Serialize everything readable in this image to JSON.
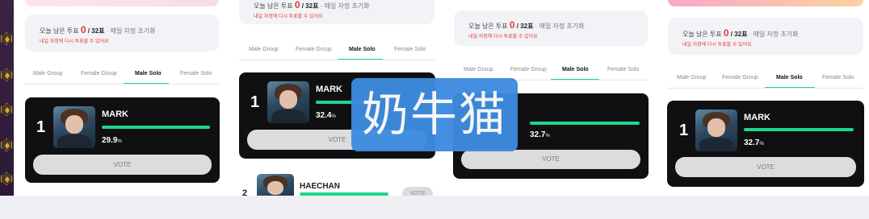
{
  "vote_info": {
    "prefix": "오늘 남은 투표 ",
    "remaining": "0",
    "total": " / 32표",
    "reset": " · 매일 자정 초기화",
    "note": "내일 자정에 다시 투표할 수 있어요"
  },
  "tabs": [
    "Male Group",
    "Female Group",
    "Male Solo",
    "Female Solo"
  ],
  "active_tab": "Male Solo",
  "panels": [
    {
      "rank": "1",
      "name": "MARK",
      "percent": "29.9",
      "unit": "%",
      "vote": "VOTE",
      "bar_fill": 0.86
    },
    {
      "rank": "1",
      "name": "MARK",
      "percent": "32.4",
      "unit": "%",
      "vote": "VOTE",
      "bar_fill": 0.55
    },
    {
      "rank": "",
      "name": "",
      "percent": "32.7",
      "unit": "%",
      "vote": "VOTE",
      "bar_fill": 0.55
    },
    {
      "rank": "1",
      "name": "MARK",
      "percent": "32.7",
      "unit": "%",
      "vote": "VOTE",
      "bar_fill": 0.9
    }
  ],
  "second_entry": {
    "rank": "2",
    "name": "HAECHAN",
    "vote": "VOTE"
  },
  "watermark": "奶牛猫",
  "colors": {
    "accent": "#1fd68a",
    "tab_underline": "#1fd3a5",
    "warning": "#e53935",
    "watermark_bg": "#3d8be0"
  }
}
